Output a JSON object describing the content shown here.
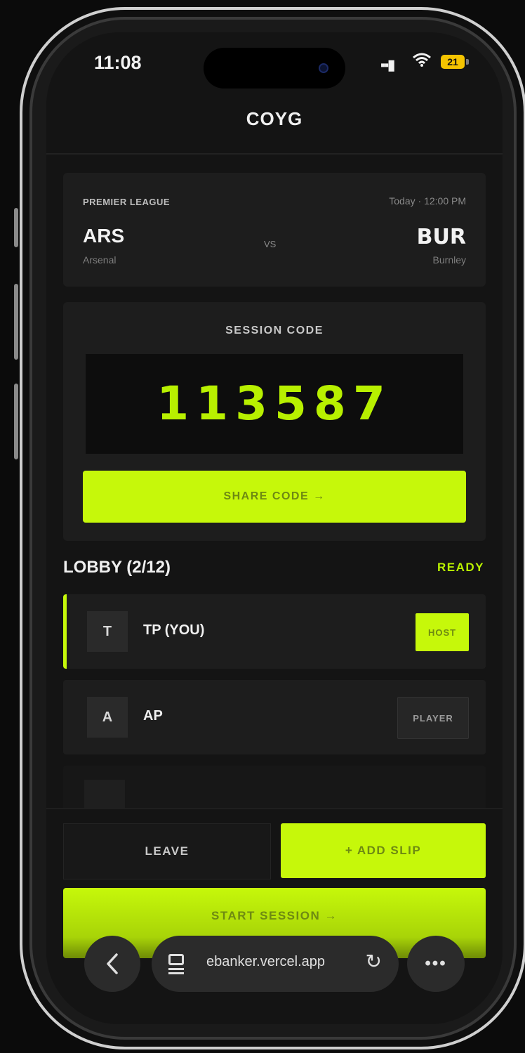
{
  "status_bar": {
    "time": "11:08",
    "battery": "21"
  },
  "header": {
    "title": "COYG"
  },
  "match": {
    "league": "PREMIER LEAGUE",
    "kickoff": "Today · 12:00 PM",
    "home_code": "ARS",
    "home_name": "Arsenal",
    "vs": "VS",
    "away_code": "BUR",
    "away_name": "Burnley"
  },
  "session": {
    "label": "SESSION CODE",
    "code": "113587",
    "share_label": "SHARE CODE →"
  },
  "lobby": {
    "title": "LOBBY (2/12)",
    "status": "READY",
    "players": [
      {
        "initial": "T",
        "name": "TP (YOU)",
        "role": "HOST"
      },
      {
        "initial": "A",
        "name": "AP",
        "role": "PLAYER"
      }
    ]
  },
  "actions": {
    "leave": "LEAVE",
    "add_slip": "+ ADD SLIP",
    "start": "START SESSION →"
  },
  "browser": {
    "url": "ebanker.vercel.app"
  },
  "colors": {
    "accent": "#c6f80a",
    "code_text": "#b8f000",
    "background": "#141414",
    "card": "#1d1d1d"
  }
}
